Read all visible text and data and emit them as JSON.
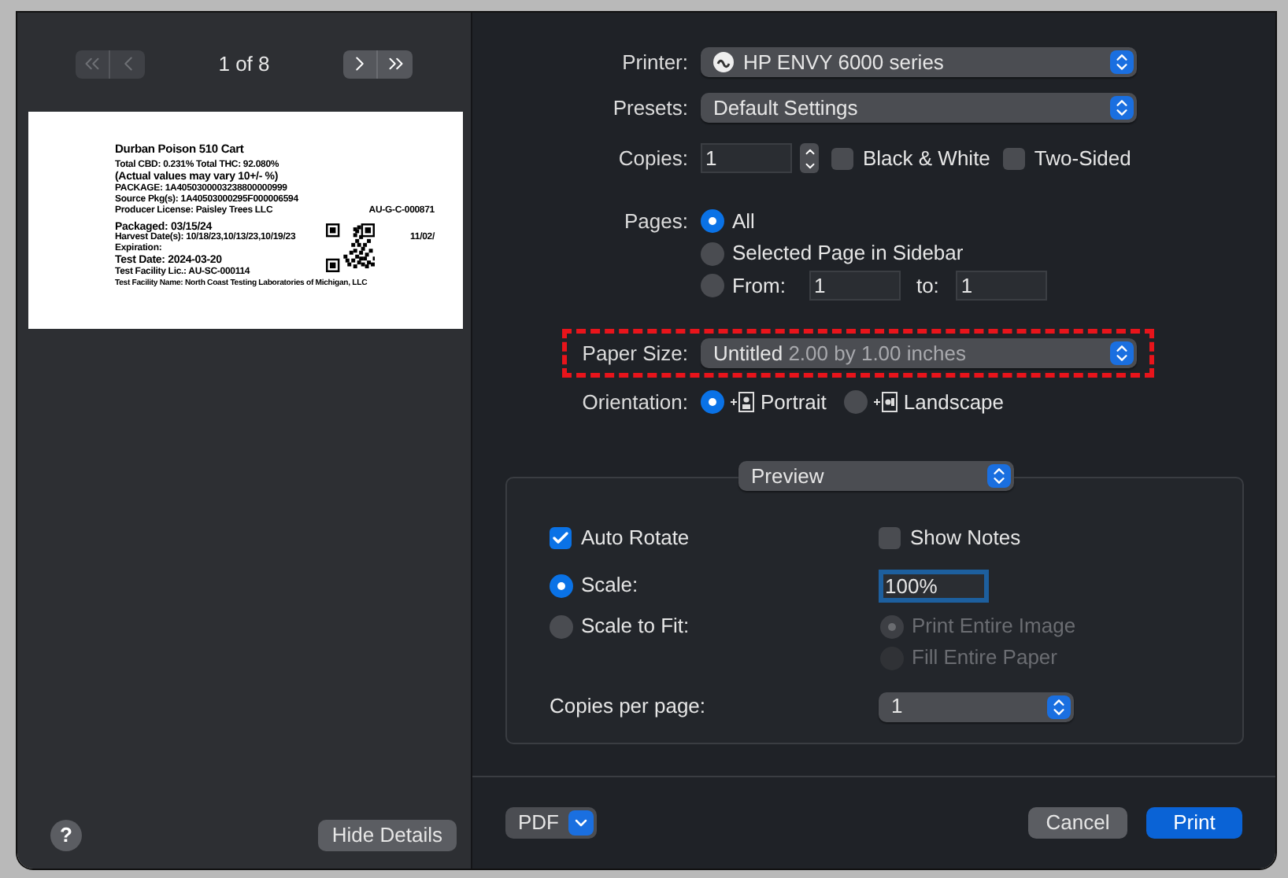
{
  "preview_nav": {
    "buttons": [
      {
        "kind": "first",
        "disabled": true
      },
      {
        "kind": "prev",
        "disabled": true
      },
      {
        "kind": "next",
        "disabled": false
      },
      {
        "kind": "last",
        "disabled": false
      }
    ],
    "page_indicator": "1 of 8"
  },
  "label_preview": {
    "title": "Durban Poison 510 Cart",
    "lines": [
      {
        "kind": "line",
        "text": "Total CBD: 0.231%  Total THC: 92.080%"
      },
      {
        "kind": "large",
        "text": "(Actual values may vary 10+/- %)"
      },
      {
        "kind": "line",
        "text": "PACKAGE:    1A4050300003238800000999"
      },
      {
        "kind": "line",
        "text": "Source Pkg(s): 1A40503000295F000006594"
      },
      {
        "kind": "pair",
        "text": "Producer License: Paisley Trees LLC",
        "extra": "AU-G-C-000871"
      },
      {
        "kind": "gap"
      },
      {
        "kind": "large",
        "text": "Packaged: 03/15/24"
      },
      {
        "kind": "pair",
        "text": "Harvest Date(s): 10/18/23,10/13/23,10/19/23",
        "extra": "11/02/"
      },
      {
        "kind": "line",
        "text": "Expiration:"
      },
      {
        "kind": "large",
        "text": "Test Date: 2024-03-20"
      },
      {
        "kind": "line",
        "text": "Test Facility Lic.: AU-SC-000114"
      },
      {
        "kind": "small",
        "text": "Test Facility Name: North Coast Testing Laboratories of Michigan, LLC"
      }
    ]
  },
  "help_button": "?",
  "hide_details_button": "Hide Details",
  "printer": {
    "label": "Printer:",
    "value": "HP ENVY 6000 series"
  },
  "presets": {
    "label": "Presets:",
    "value": "Default Settings"
  },
  "copies": {
    "label": "Copies:",
    "value": "1"
  },
  "print_options": [
    {
      "label": "Black & White",
      "checked": false
    },
    {
      "label": "Two-Sided",
      "checked": false
    }
  ],
  "pages": {
    "label": "Pages:",
    "choices": [
      {
        "kind": "all",
        "label": "All",
        "selected": true
      },
      {
        "kind": "sidebar",
        "label": "Selected Page in Sidebar",
        "selected": false
      },
      {
        "kind": "range",
        "label": "From:",
        "selected": false,
        "from": "1",
        "to_label": "to:",
        "to": "1"
      }
    ]
  },
  "paper_size": {
    "label": "Paper Size:",
    "name": "Untitled",
    "detail": "2.00 by 1.00 inches",
    "highlighted": true
  },
  "orientation": {
    "label": "Orientation:",
    "choices": [
      {
        "kind": "portrait",
        "label": "Portrait",
        "selected": true
      },
      {
        "kind": "landscape",
        "label": "Landscape",
        "selected": false
      }
    ]
  },
  "section_menu": "Preview",
  "auto_rotate": {
    "label": "Auto Rotate",
    "checked": true
  },
  "show_notes": {
    "label": "Show Notes",
    "checked": false
  },
  "scale_modes": [
    {
      "label": "Scale:",
      "selected": true
    },
    {
      "label": "Scale to Fit:",
      "selected": false
    }
  ],
  "scale_value": "100%",
  "fit_options": [
    {
      "label": "Print Entire Image",
      "selected": true,
      "disabled": true
    },
    {
      "label": "Fill Entire Paper",
      "selected": false,
      "disabled": true
    }
  ],
  "copies_per_page": {
    "label": "Copies per page:",
    "value": "1"
  },
  "pdf_button": "PDF",
  "cancel_button": "Cancel",
  "print_button": "Print"
}
